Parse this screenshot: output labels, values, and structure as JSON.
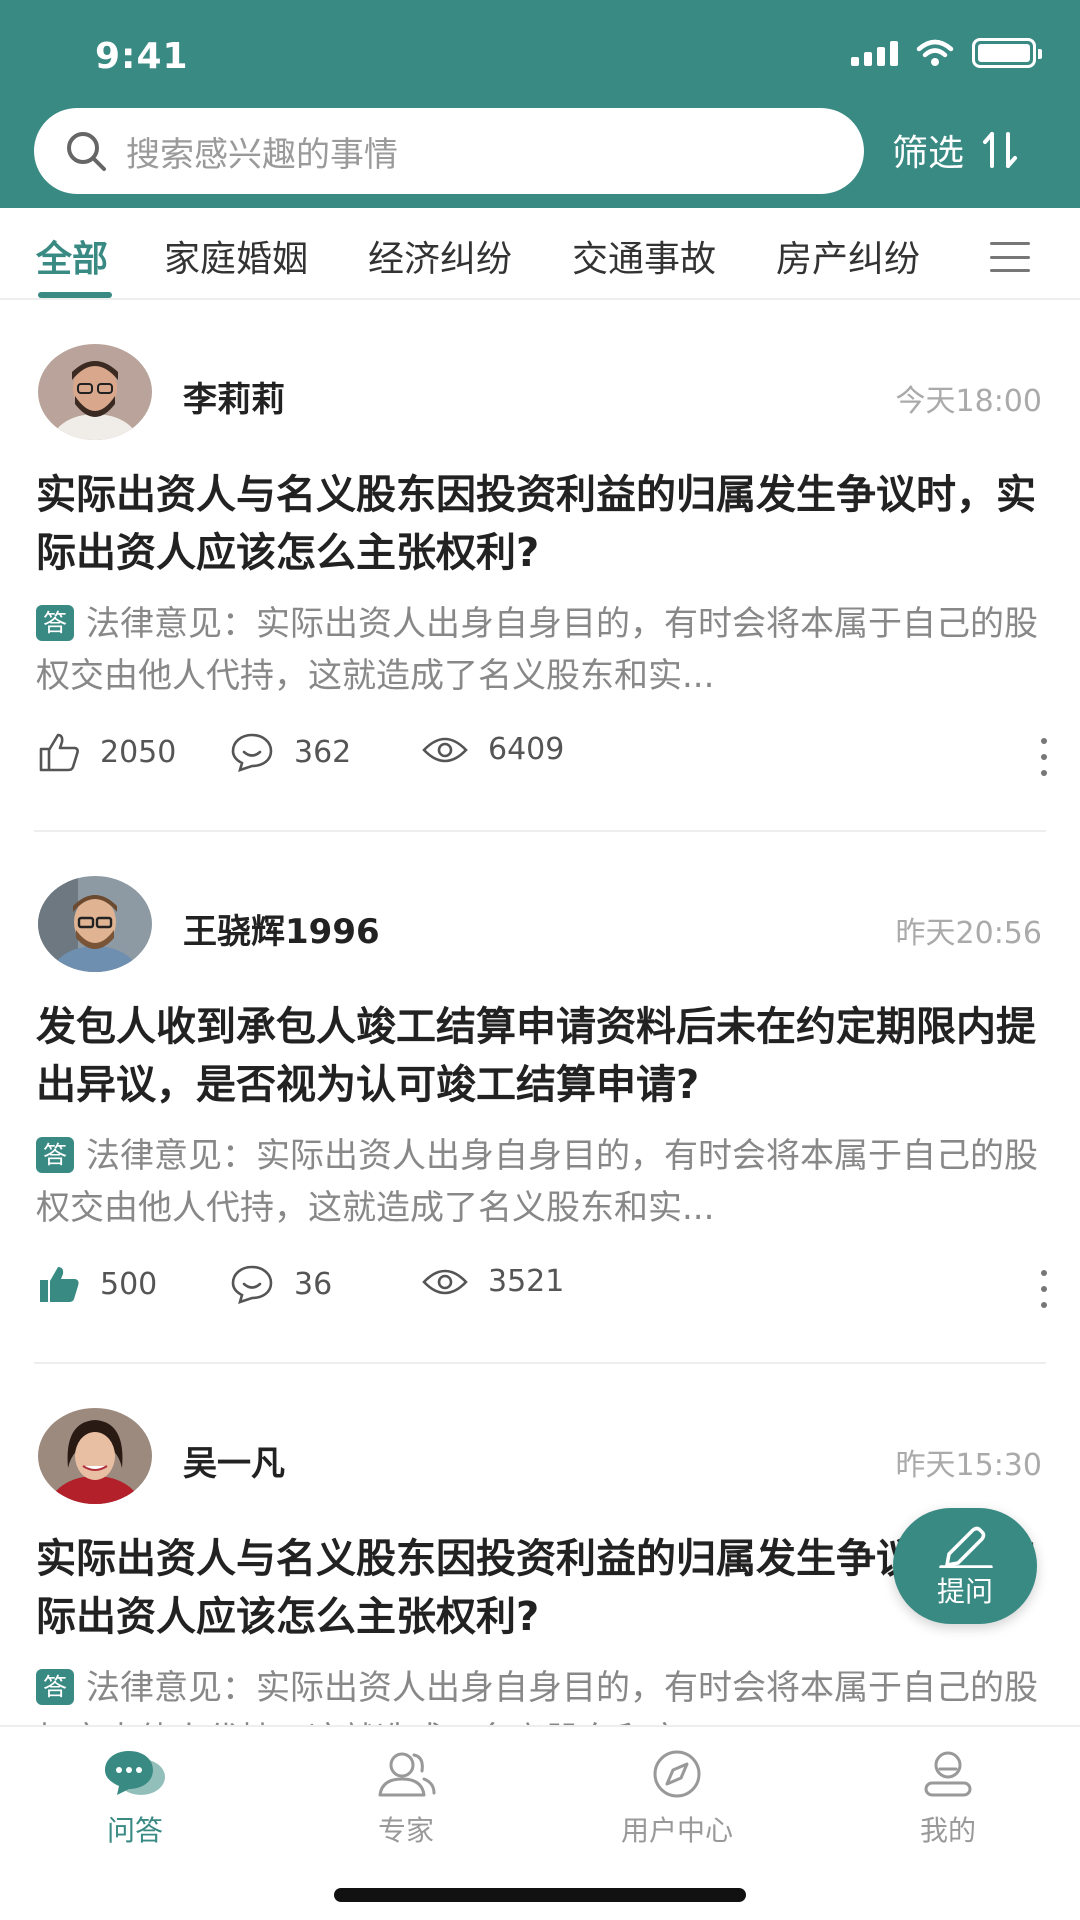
{
  "status_bar": {
    "time": "9:41"
  },
  "search": {
    "placeholder": "搜索感兴趣的事情",
    "filter_label": "筛选"
  },
  "tabs": [
    {
      "label": "全部",
      "active": true
    },
    {
      "label": "家庭婚姻"
    },
    {
      "label": "经济纠纷"
    },
    {
      "label": "交通事故"
    },
    {
      "label": "房产纠纷"
    }
  ],
  "posts": [
    {
      "username": "李莉莉",
      "time": "今天18:00",
      "title": "实际出资人与名义股东因投资利益的归属发生争议时，实际出资人应该怎么主张权利?",
      "answer_badge": "答",
      "answer": "法律意见：实际出资人出身自身目的，有时会将本属于自己的股权交由他人代持，这就造成了名义股东和实...",
      "likes": "2050",
      "comments": "362",
      "views": "6409",
      "liked": false
    },
    {
      "username": "王骁辉1996",
      "time": "昨天20:56",
      "title": "发包人收到承包人竣工结算申请资料后未在约定期限内提出异议，是否视为认可竣工结算申请?",
      "answer_badge": "答",
      "answer": "法律意见：实际出资人出身自身目的，有时会将本属于自己的股权交由他人代持，这就造成了名义股东和实...",
      "likes": "500",
      "comments": "36",
      "views": "3521",
      "liked": true
    },
    {
      "username": "吴一凡",
      "time": "昨天15:30",
      "title": "实际出资人与名义股东因投资利益的归属发生争议时，实际出资人应该怎么主张权利?",
      "answer_badge": "答",
      "answer": "法律意见：实际出资人出身自身目的，有时会将本属于自己的股权交由他人代持，这就造成了名义股东和实...",
      "likes": "",
      "comments": "",
      "views": "",
      "liked": false
    }
  ],
  "fab": {
    "label": "提问"
  },
  "bottom_nav": [
    {
      "label": "问答",
      "icon": "chat-bubbles-icon",
      "active": true
    },
    {
      "label": "专家",
      "icon": "users-icon"
    },
    {
      "label": "用户中心",
      "icon": "compass-icon"
    },
    {
      "label": "我的",
      "icon": "profile-icon"
    }
  ],
  "colors": {
    "primary": "#3a8a84",
    "text": "#222222",
    "muted": "#888888"
  }
}
